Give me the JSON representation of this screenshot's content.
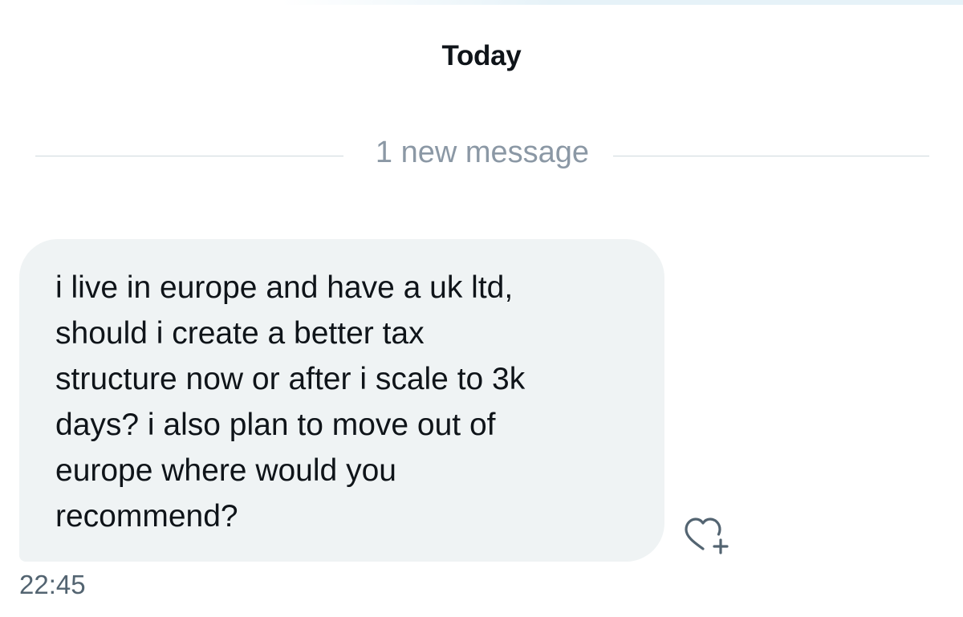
{
  "header": {
    "date_label": "Today"
  },
  "divider": {
    "label": "1 new message"
  },
  "message": {
    "text": "i live in europe and have a uk ltd,\nshould i create a better tax\nstructure now or after i scale to 3k\ndays? i also plan to move out of\neurope where would you\nrecommend?",
    "timestamp": "22:45",
    "react_icon": "heart-plus-icon"
  },
  "colors": {
    "bubble_background": "#eff3f4",
    "text_primary": "#0f1419",
    "text_secondary": "#536471",
    "divider_text": "#8b98a5",
    "divider_line": "#cfd9de"
  }
}
